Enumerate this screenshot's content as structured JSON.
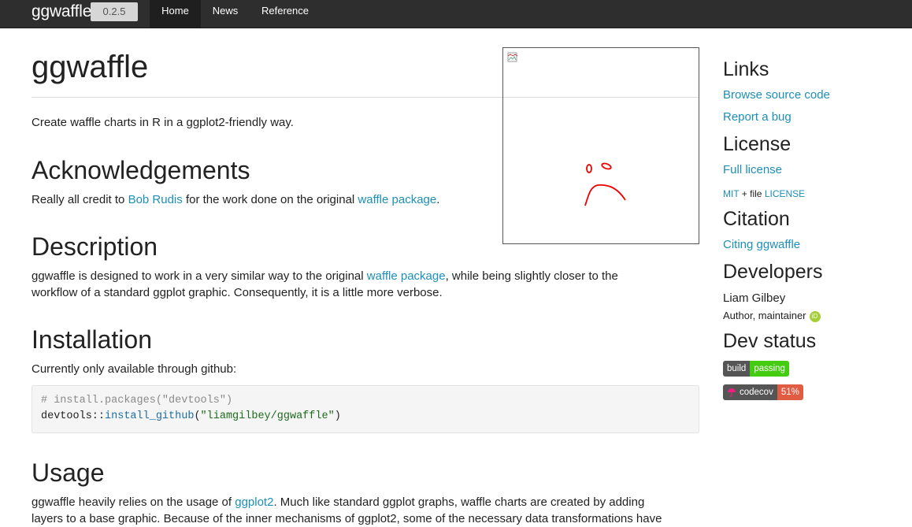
{
  "navbar": {
    "brand": "ggwaffle",
    "version": "0.2.5",
    "items": [
      {
        "label": "Home",
        "active": true
      },
      {
        "label": "News",
        "active": false
      },
      {
        "label": "Reference",
        "active": false
      }
    ]
  },
  "main": {
    "title": "ggwaffle",
    "intro": "Create waffle charts in R in a ggplot2-friendly way.",
    "ack": {
      "heading": "Acknowledgements",
      "text_before": "Really all credit to ",
      "link1": "Bob Rudis",
      "text_mid": " for the work done on the original ",
      "link2": "waffle package",
      "text_after": "."
    },
    "description": {
      "heading": "Description",
      "line1_before": "ggwaffle is designed to work in a very similar way to the original ",
      "line1_link": "waffle package",
      "line1_after": ", while being slightly closer to the",
      "line2": "workflow of a standard ggplot graphic. Consequently, it is a little more verbose."
    },
    "installation": {
      "heading": "Installation",
      "text": "Currently only available through github:",
      "code_comment": "# install.packages(\"devtools\")",
      "code_pkg": "devtools::",
      "code_fn": "install_github",
      "code_open": "(",
      "code_str": "\"liamgilbey/ggwaffle\"",
      "code_close": ")"
    },
    "usage": {
      "heading": "Usage",
      "text_before": "ggwaffle heavily relies on the usage of ",
      "link": "ggplot2",
      "text_after": ". Much like standard ggplot graphs, waffle charts are created by adding",
      "line2": "layers to a base graphic. Because of the inner mechanisms of ggplot2, some of the necessary data transformations have"
    }
  },
  "sidebar": {
    "links_heading": "Links",
    "browse": "Browse source code",
    "report": "Report a bug",
    "license_heading": "License",
    "full_license": "Full license",
    "mit": "MIT",
    "plus_file": " + file ",
    "license_file": "LICENSE",
    "citation_heading": "Citation",
    "citing": "Citing ggwaffle",
    "developers_heading": "Developers",
    "dev_name": "Liam Gilbey",
    "dev_role": "Author, maintainer",
    "orcid": "iD",
    "devstatus_heading": "Dev status",
    "badge_build_left": "build",
    "badge_build_right": "passing",
    "badge_cov_left": "codecov",
    "badge_cov_right": "51%"
  },
  "colors": {
    "link": "#1d8fb9",
    "navbar": "#2e2e2e",
    "badge_pass": "#4c1",
    "badge_cov": "#e05d44"
  }
}
